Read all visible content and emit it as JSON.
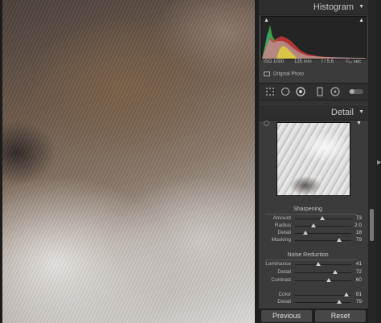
{
  "histogram": {
    "title": "Histogram",
    "iso": "ISO 1000",
    "focal_length": "135 mm",
    "aperture": "f / 5.6",
    "shutter": "¹⁄₄₀ sec",
    "original_photo_label": "Original Photo"
  },
  "detail": {
    "title": "Detail",
    "sharpening": {
      "title": "Sharpening",
      "rows": [
        {
          "label": "Amount",
          "value": "73",
          "fraction": 0.49
        },
        {
          "label": "Radius",
          "value": "2.0",
          "fraction": 0.33
        },
        {
          "label": "Detail",
          "value": "18",
          "fraction": 0.18
        },
        {
          "label": "Masking",
          "value": "79",
          "fraction": 0.79
        }
      ]
    },
    "noise_reduction": {
      "title": "Noise Reduction",
      "rows": [
        {
          "label": "Luminance",
          "value": "41",
          "fraction": 0.41
        },
        {
          "label": "Detail",
          "value": "72",
          "fraction": 0.72
        },
        {
          "label": "Contrast",
          "value": "60",
          "fraction": 0.6
        },
        {
          "label": "Color",
          "value": "91",
          "fraction": 0.91
        },
        {
          "label": "Detail",
          "value": "79",
          "fraction": 0.79
        }
      ]
    }
  },
  "buttons": {
    "previous": "Previous",
    "reset": "Reset"
  },
  "icons": {
    "panel_collapse": "triangle-down-icon",
    "clip_warning": "triangle-up-icon",
    "tools": [
      "crop-overlay-icon",
      "spot-removal-icon",
      "red-eye-icon",
      "graduated-filter-icon",
      "radial-filter-icon",
      "adjustment-brush-icon"
    ]
  }
}
